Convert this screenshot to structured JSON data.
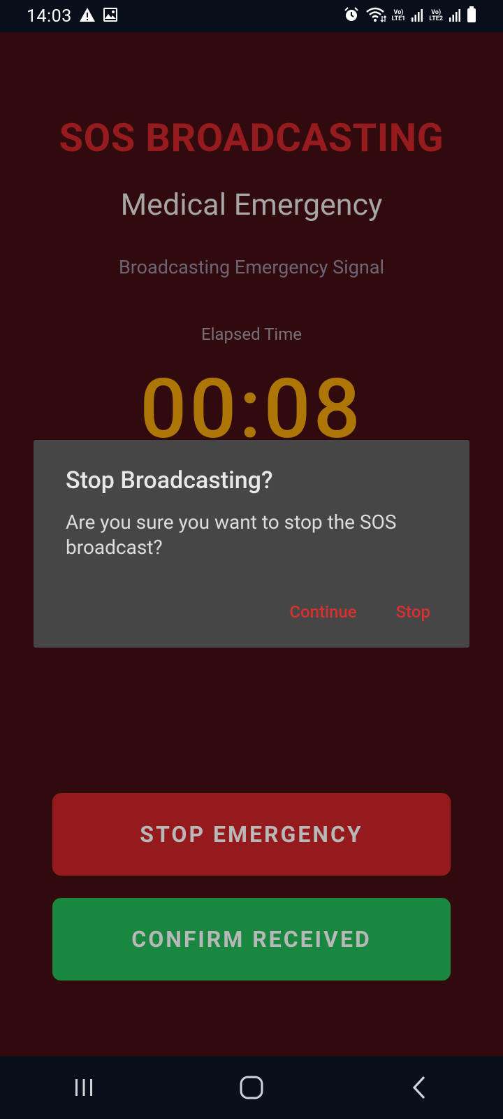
{
  "status_bar": {
    "time": "14:03",
    "left_icons": [
      "warning-icon",
      "image-icon"
    ],
    "right_icons": [
      "alarm-icon",
      "wifi-icon",
      "volte-lte1-icon",
      "signal-icon",
      "volte-lte2-icon",
      "signal-icon",
      "battery-icon"
    ],
    "lte1_top": "Vo)",
    "lte1_bottom": "LTE1",
    "lte2_top": "Vo)",
    "lte2_bottom": "LTE2"
  },
  "screen": {
    "title": "SOS BROADCASTING",
    "emergency_type": "Medical Emergency",
    "signal_status": "Broadcasting Emergency Signal",
    "elapsed_label": "Elapsed Time",
    "elapsed_time": "00:08",
    "stop_button": "STOP EMERGENCY",
    "confirm_button": "CONFIRM RECEIVED"
  },
  "dialog": {
    "title": "Stop Broadcasting?",
    "message": "Are you sure you want to stop the SOS broadcast?",
    "continue_label": "Continue",
    "stop_label": "Stop"
  },
  "nav_bar": {
    "icons": [
      "recent-apps-icon",
      "home-icon",
      "back-icon"
    ]
  },
  "colors": {
    "background": "#300a0c",
    "title": "#951b1e",
    "timer": "#ad7606",
    "stop_button": "#951a1d",
    "confirm_button": "#19873f",
    "dialog": "#464646",
    "dialog_action": "#d82f2f"
  }
}
